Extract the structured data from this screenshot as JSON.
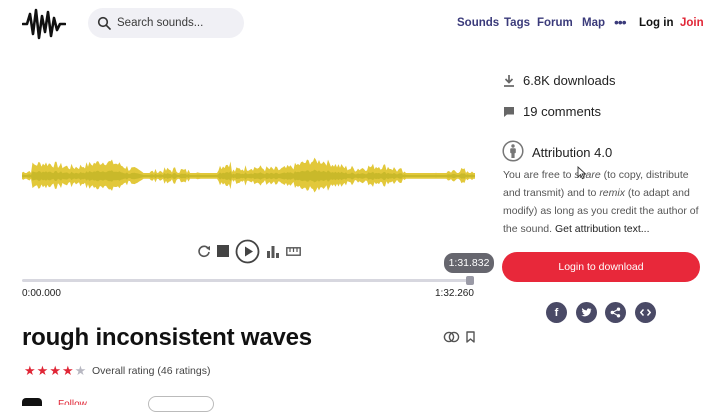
{
  "header": {
    "search_placeholder": "Search sounds...",
    "nav": {
      "sounds": "Sounds",
      "tags": "Tags",
      "forum": "Forum",
      "map": "Map",
      "more": "•••",
      "login": "Log in",
      "join": "Join"
    }
  },
  "player": {
    "tooltip_time": "1:31.832",
    "start_time": "0:00.000",
    "end_time": "1:32.260",
    "wave_color": "#e2c83a"
  },
  "sound": {
    "title": "rough inconsistent waves",
    "rating_text": "Overall rating (46 ratings)",
    "stars_filled": 4,
    "stars_total": 5,
    "follow_label": "Follow"
  },
  "sidebar": {
    "downloads": "6.8K downloads",
    "comments": "19 comments",
    "license_title": "Attribution 4.0",
    "license_text_1": "You are free to ",
    "license_share": "share",
    "license_text_2": " (to copy, distribute and transmit) and to ",
    "license_remix": "remix",
    "license_text_3": " (to adapt and modify) as long as you credit the author of the sound. ",
    "license_link": "Get attribution text...",
    "login_button": "Login to download",
    "share_icons": [
      "facebook-icon",
      "twitter-icon",
      "share-icon",
      "embed-icon"
    ]
  },
  "colors": {
    "accent": "#e8283a",
    "nav": "#3a3a7a",
    "share_bg": "#4a4a66"
  }
}
